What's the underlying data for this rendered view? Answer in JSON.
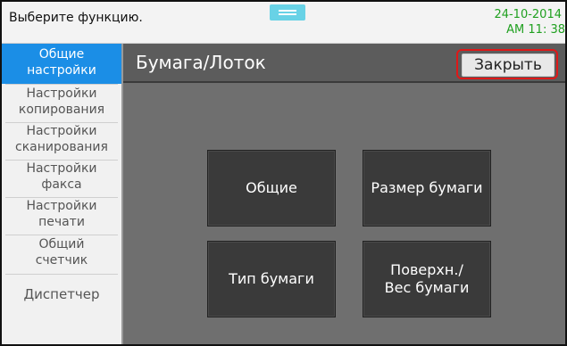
{
  "statusbar": {
    "prompt": "Выберите функцию.",
    "date": "24-10-2014",
    "time": "AM 11: 38"
  },
  "sidebar": {
    "items": [
      {
        "label": "Общие\nнастройки",
        "active": true
      },
      {
        "label": "Настройки\nкопирования"
      },
      {
        "label": "Настройки\nсканирования"
      },
      {
        "label": "Настройки\nфакса"
      },
      {
        "label": "Настройки\nпечати"
      },
      {
        "label": "Общий\nсчетчик"
      },
      {
        "label": "Диспетчер"
      }
    ]
  },
  "header": {
    "title": "Бумага/Лоток",
    "close_label": "Закрыть"
  },
  "tiles": {
    "general": "Общие",
    "paper_size": "Размер бумаги",
    "paper_type": "Тип бумаги",
    "surface_weight": "Поверхн./\nВес бумаги"
  },
  "colors": {
    "accent": "#1b8ee6",
    "date_color": "#20a020",
    "highlight": "#e01818"
  }
}
